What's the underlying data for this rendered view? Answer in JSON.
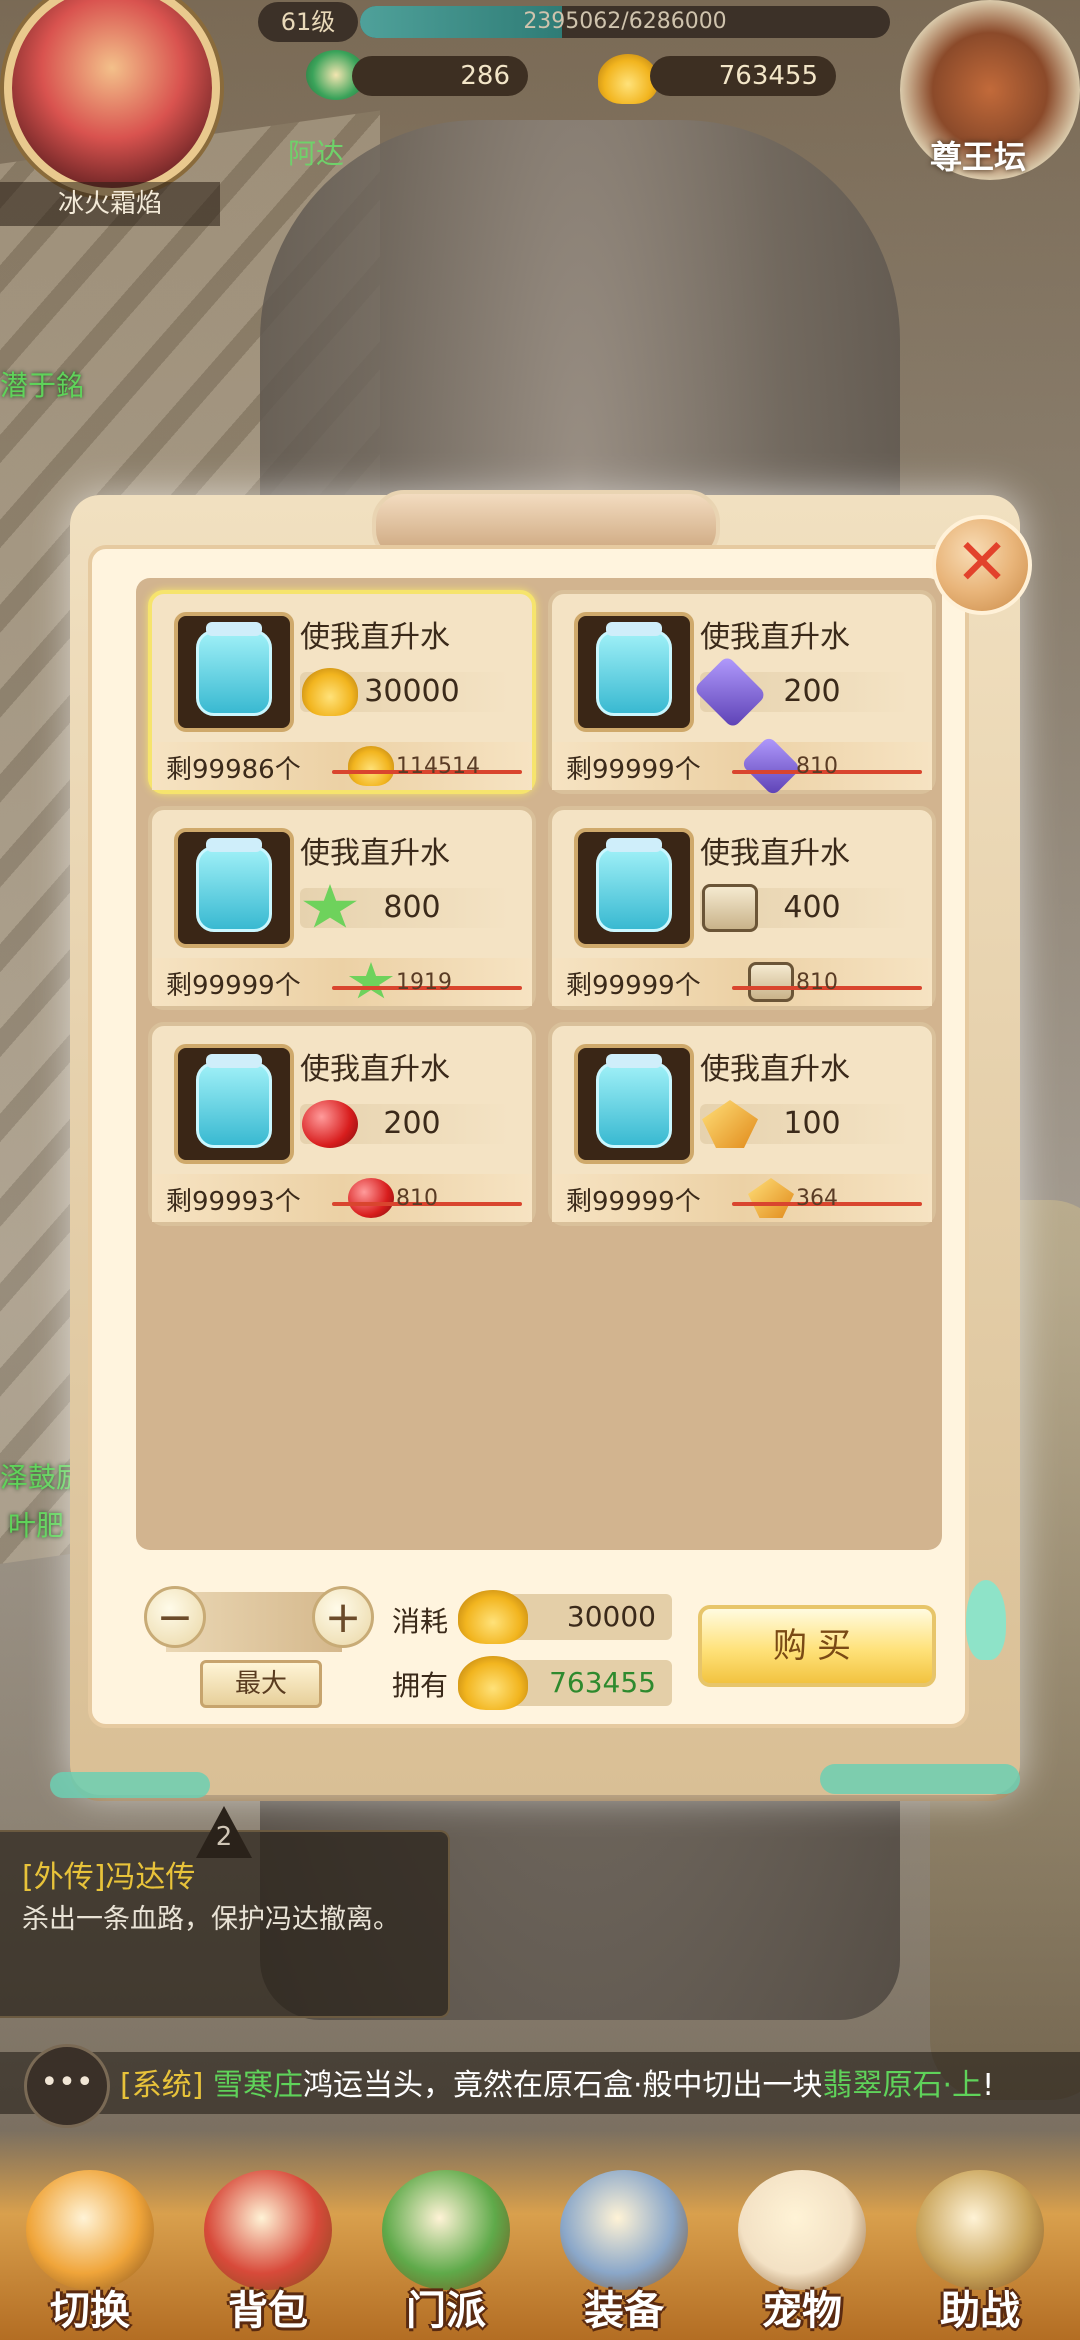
{
  "hud": {
    "player_name": "冰火霜焰",
    "level": "61级",
    "exp_text": "2395062/6286000",
    "exp_fraction": 0.381,
    "currency_jade": "286",
    "currency_gold": "763455",
    "friend_label": "阿达",
    "altar_label": "尊王坛"
  },
  "side_names": [
    "潜于銘",
    "泽鼓励",
    "叶肥"
  ],
  "shop": {
    "items": [
      {
        "name": "使我直升水",
        "price": "30000",
        "currency_icon": "gold-ingot-icon",
        "stock": "剩99986个",
        "original": "114514",
        "selected": true
      },
      {
        "name": "使我直升水",
        "price": "200",
        "currency_icon": "purple-crystal-icon",
        "stock": "剩99999个",
        "original": "810",
        "selected": false
      },
      {
        "name": "使我直升水",
        "price": "800",
        "currency_icon": "green-star-icon",
        "stock": "剩99999个",
        "original": "1919",
        "selected": false
      },
      {
        "name": "使我直升水",
        "price": "400",
        "currency_icon": "paw-scroll-icon",
        "stock": "剩99999个",
        "original": "810",
        "selected": false
      },
      {
        "name": "使我直升水",
        "price": "200",
        "currency_icon": "red-gem-icon",
        "stock": "剩99993个",
        "original": "810",
        "selected": false
      },
      {
        "name": "使我直升水",
        "price": "100",
        "currency_icon": "orange-crystal-icon",
        "stock": "剩99999个",
        "original": "364",
        "selected": false
      }
    ],
    "minus_label": "−",
    "plus_label": "+",
    "max_label": "最大",
    "cost_label": "消耗",
    "cost_value": "30000",
    "own_label": "拥有",
    "own_value": "763455",
    "buy_label": "购买",
    "close_label": "✕"
  },
  "quest": {
    "badge": "2",
    "title": "[外传]冯达传",
    "desc": "杀出一条血路，保护冯达撤离。"
  },
  "chat": {
    "channel": "[系统]",
    "player": "雪寒庄",
    "text1": "鸿运当头，竟然在原石盒·般中切出一块",
    "item": "翡翠原石·上",
    "text2": "!"
  },
  "nav": [
    {
      "label": "切换",
      "icon": "switch-icon"
    },
    {
      "label": "背包",
      "icon": "bag-icon"
    },
    {
      "label": "门派",
      "icon": "sect-icon"
    },
    {
      "label": "装备",
      "icon": "equipment-icon"
    },
    {
      "label": "宠物",
      "icon": "pet-icon"
    },
    {
      "label": "助战",
      "icon": "assist-icon"
    }
  ],
  "colors": {
    "accent_green": "#6fd16a",
    "gold": "#f2b51f",
    "close_red": "#e2422c",
    "strike_red": "#d9452e"
  }
}
